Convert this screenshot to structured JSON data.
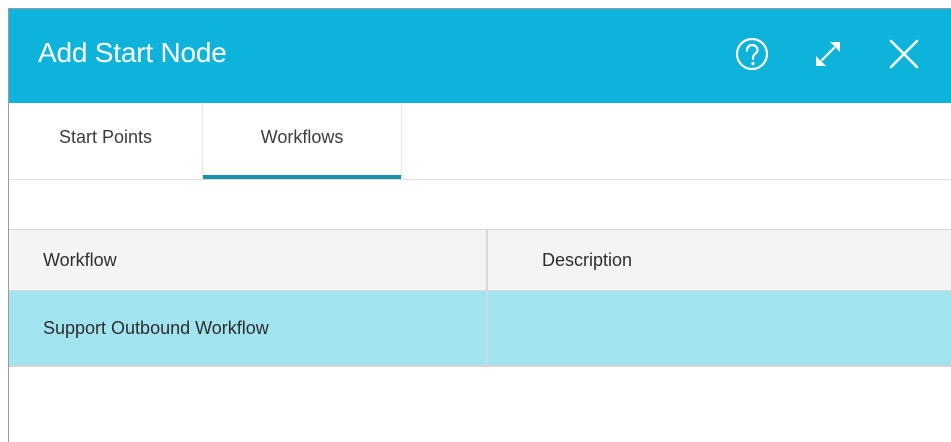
{
  "dialog": {
    "title": "Add Start Node",
    "header_color": "#0db3db",
    "icons": [
      "help-icon",
      "expand-icon",
      "close-icon"
    ]
  },
  "tabs": [
    {
      "label": "Start Points",
      "active": false
    },
    {
      "label": "Workflows",
      "active": true
    }
  ],
  "table": {
    "columns": [
      "Workflow",
      "Description"
    ],
    "rows": [
      {
        "workflow": "Support Outbound Workflow",
        "description": "",
        "selected": true
      }
    ],
    "selected_row_color": "#a2e3f0"
  }
}
